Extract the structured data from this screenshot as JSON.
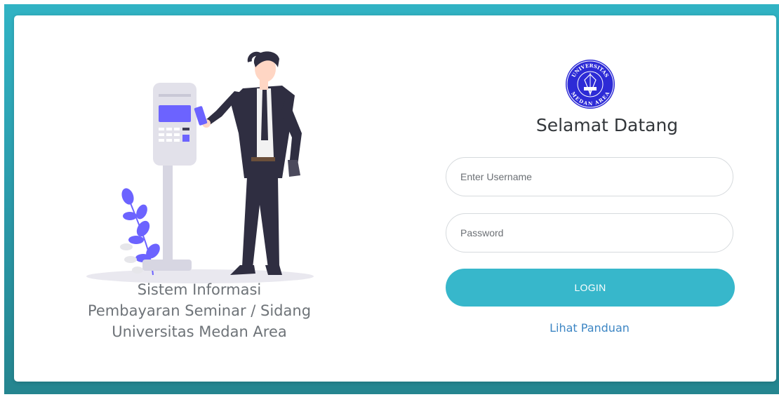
{
  "illustration": {
    "alt": "man using card payment terminal"
  },
  "tagline": {
    "line1": "Sistem Informasi",
    "line2": "Pembayaran Seminar / Sidang",
    "line3": "Universitas Medan Area"
  },
  "logo": {
    "icon": "university-seal-icon",
    "top_text": "UNIVERSITAS",
    "bottom_text": "MEDAN AREA",
    "color": "#2d2bd6"
  },
  "welcome": "Selamat Datang",
  "form": {
    "username_placeholder": "Enter Username",
    "password_placeholder": "Password",
    "login_label": "LOGIN",
    "guide_link": "Lihat Panduan"
  },
  "colors": {
    "frame": "#31b3c4",
    "button": "#37b7cb",
    "link": "#3d86c4",
    "accent_illustration": "#6c63ff"
  }
}
